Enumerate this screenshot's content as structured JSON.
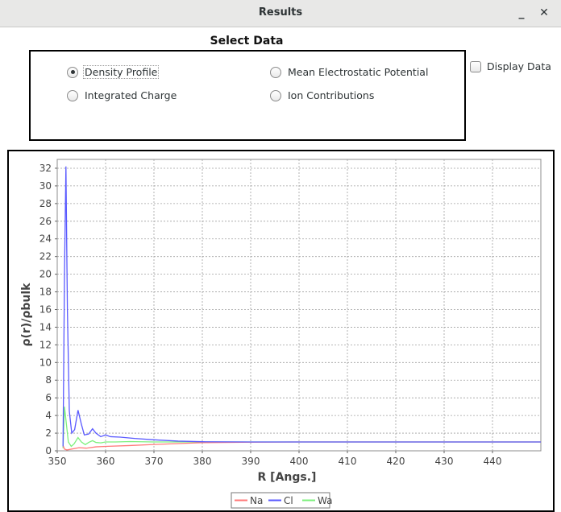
{
  "window": {
    "title": "Results",
    "minimize_glyph": "_",
    "close_glyph": "✕"
  },
  "select": {
    "title": "Select Data",
    "options": [
      {
        "label": "Density Profile",
        "selected": true
      },
      {
        "label": "Mean Electrostatic Potential",
        "selected": false
      },
      {
        "label": "Integrated Charge",
        "selected": false
      },
      {
        "label": "Ion Contributions",
        "selected": false
      }
    ]
  },
  "display_data": {
    "label": "Display Data",
    "checked": false
  },
  "chart_data": {
    "type": "line",
    "xlabel": "R [Angs.]",
    "ylabel": "ρ(r)/ρbulk",
    "xlim": [
      350,
      450
    ],
    "ylim": [
      0,
      33
    ],
    "xticks": [
      350,
      360,
      370,
      380,
      390,
      400,
      410,
      420,
      430,
      440
    ],
    "yticks": [
      0,
      2,
      4,
      6,
      8,
      10,
      12,
      14,
      16,
      18,
      20,
      22,
      24,
      26,
      28,
      30,
      32
    ],
    "grid": true,
    "legend": "bottom-center",
    "series": [
      {
        "name": "Na",
        "color": "#ff7a7a",
        "points": [
          [
            351.2,
            0.6
          ],
          [
            351.5,
            0.2
          ],
          [
            352,
            0.1
          ],
          [
            353,
            0.2
          ],
          [
            354.5,
            0.35
          ],
          [
            356,
            0.3
          ],
          [
            358,
            0.45
          ],
          [
            360,
            0.5
          ],
          [
            365,
            0.6
          ],
          [
            370,
            0.72
          ],
          [
            375,
            0.82
          ],
          [
            380,
            0.92
          ],
          [
            390,
            0.98
          ],
          [
            400,
            1.0
          ],
          [
            450,
            1.0
          ]
        ]
      },
      {
        "name": "Cl",
        "color": "#5a5aff",
        "points": [
          [
            351.2,
            0.5
          ],
          [
            351.5,
            20.0
          ],
          [
            351.8,
            32.2
          ],
          [
            352.1,
            16.0
          ],
          [
            352.5,
            4.5
          ],
          [
            353.0,
            2.0
          ],
          [
            353.6,
            2.4
          ],
          [
            354.3,
            4.6
          ],
          [
            355.0,
            3.0
          ],
          [
            355.6,
            1.8
          ],
          [
            356.5,
            1.9
          ],
          [
            357.3,
            2.5
          ],
          [
            358.0,
            2.0
          ],
          [
            359.0,
            1.6
          ],
          [
            360.0,
            1.8
          ],
          [
            361.0,
            1.6
          ],
          [
            363,
            1.55
          ],
          [
            366,
            1.4
          ],
          [
            370,
            1.25
          ],
          [
            375,
            1.1
          ],
          [
            380,
            1.03
          ],
          [
            390,
            1.0
          ],
          [
            450,
            1.0
          ]
        ]
      },
      {
        "name": "Wa",
        "color": "#7df07d",
        "points": [
          [
            351.2,
            0.3
          ],
          [
            351.5,
            5.0
          ],
          [
            351.8,
            3.5
          ],
          [
            352.3,
            1.0
          ],
          [
            352.9,
            0.5
          ],
          [
            353.5,
            0.8
          ],
          [
            354.3,
            1.5
          ],
          [
            355.0,
            1.0
          ],
          [
            355.8,
            0.7
          ],
          [
            356.5,
            0.95
          ],
          [
            357.3,
            1.15
          ],
          [
            358.0,
            0.95
          ],
          [
            359,
            0.9
          ],
          [
            360,
            1.0
          ],
          [
            362,
            1.0
          ],
          [
            365,
            1.05
          ],
          [
            370,
            1.0
          ],
          [
            380,
            1.0
          ],
          [
            450,
            1.0
          ]
        ]
      }
    ]
  }
}
